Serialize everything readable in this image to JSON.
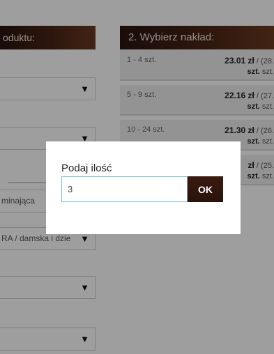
{
  "left_column": {
    "header": "oduktu:",
    "selects": [
      {
        "value": ""
      },
      {
        "value": ""
      },
      {
        "value": "minająca"
      },
      {
        "value": "RA / damska i dzie"
      },
      {
        "value": ""
      },
      {
        "value": ""
      }
    ],
    "dropdown_arrow": "▼"
  },
  "right_column": {
    "header": "2. Wybierz nakład:",
    "price_rows": [
      {
        "qty": "1 - 4 szt.",
        "price": "23.01 zł",
        "alt": " / (28.",
        "unit": "szt.",
        "unit2": "szt."
      },
      {
        "qty": "5 - 9 szt.",
        "price": "22.16 zł",
        "alt": " / (27.",
        "unit": "szt.",
        "unit2": "szt."
      },
      {
        "qty": "10 - 24 szt.",
        "price": "21.30 zł",
        "alt": " / (26.",
        "unit": "szt.",
        "unit2": "szt."
      },
      {
        "qty": "",
        "price": "zł",
        "alt": " / (25.",
        "unit": "szt.",
        "unit2": "szt."
      }
    ]
  },
  "modal": {
    "title": "Podaj ilość",
    "input_value": "3",
    "ok_label": "OK"
  }
}
